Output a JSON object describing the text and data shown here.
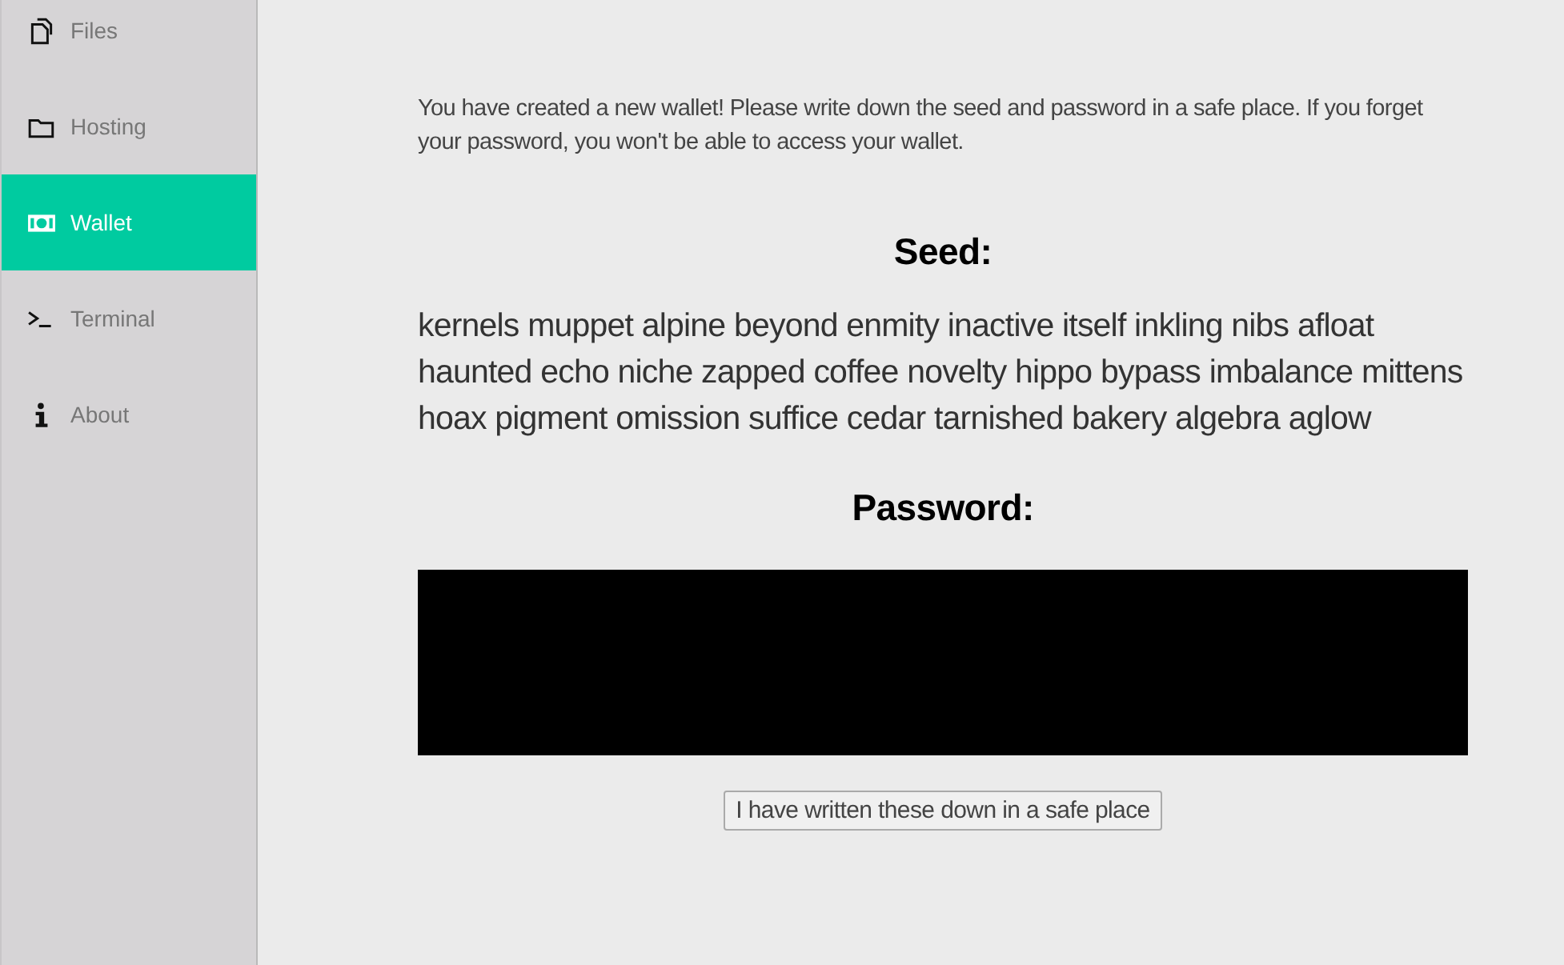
{
  "sidebar": {
    "items": [
      {
        "label": "Files",
        "selected": false
      },
      {
        "label": "Hosting",
        "selected": false
      },
      {
        "label": "Wallet",
        "selected": true
      },
      {
        "label": "Terminal",
        "selected": false
      },
      {
        "label": "About",
        "selected": false
      }
    ]
  },
  "main": {
    "intro": "You have created a new wallet! Please write down the seed and password in a safe place. If you forget your password, you won't be able to access your wallet.",
    "seed_heading": "Seed:",
    "seed": "kernels muppet alpine beyond enmity inactive itself inkling nibs afloat haunted echo niche zapped coffee novelty hippo bypass imbalance mittens hoax pigment omission suffice cedar tarnished bakery algebra aglow",
    "password_heading": "Password:",
    "password_redacted": true,
    "confirm_button": "I have written these down in a safe place"
  }
}
